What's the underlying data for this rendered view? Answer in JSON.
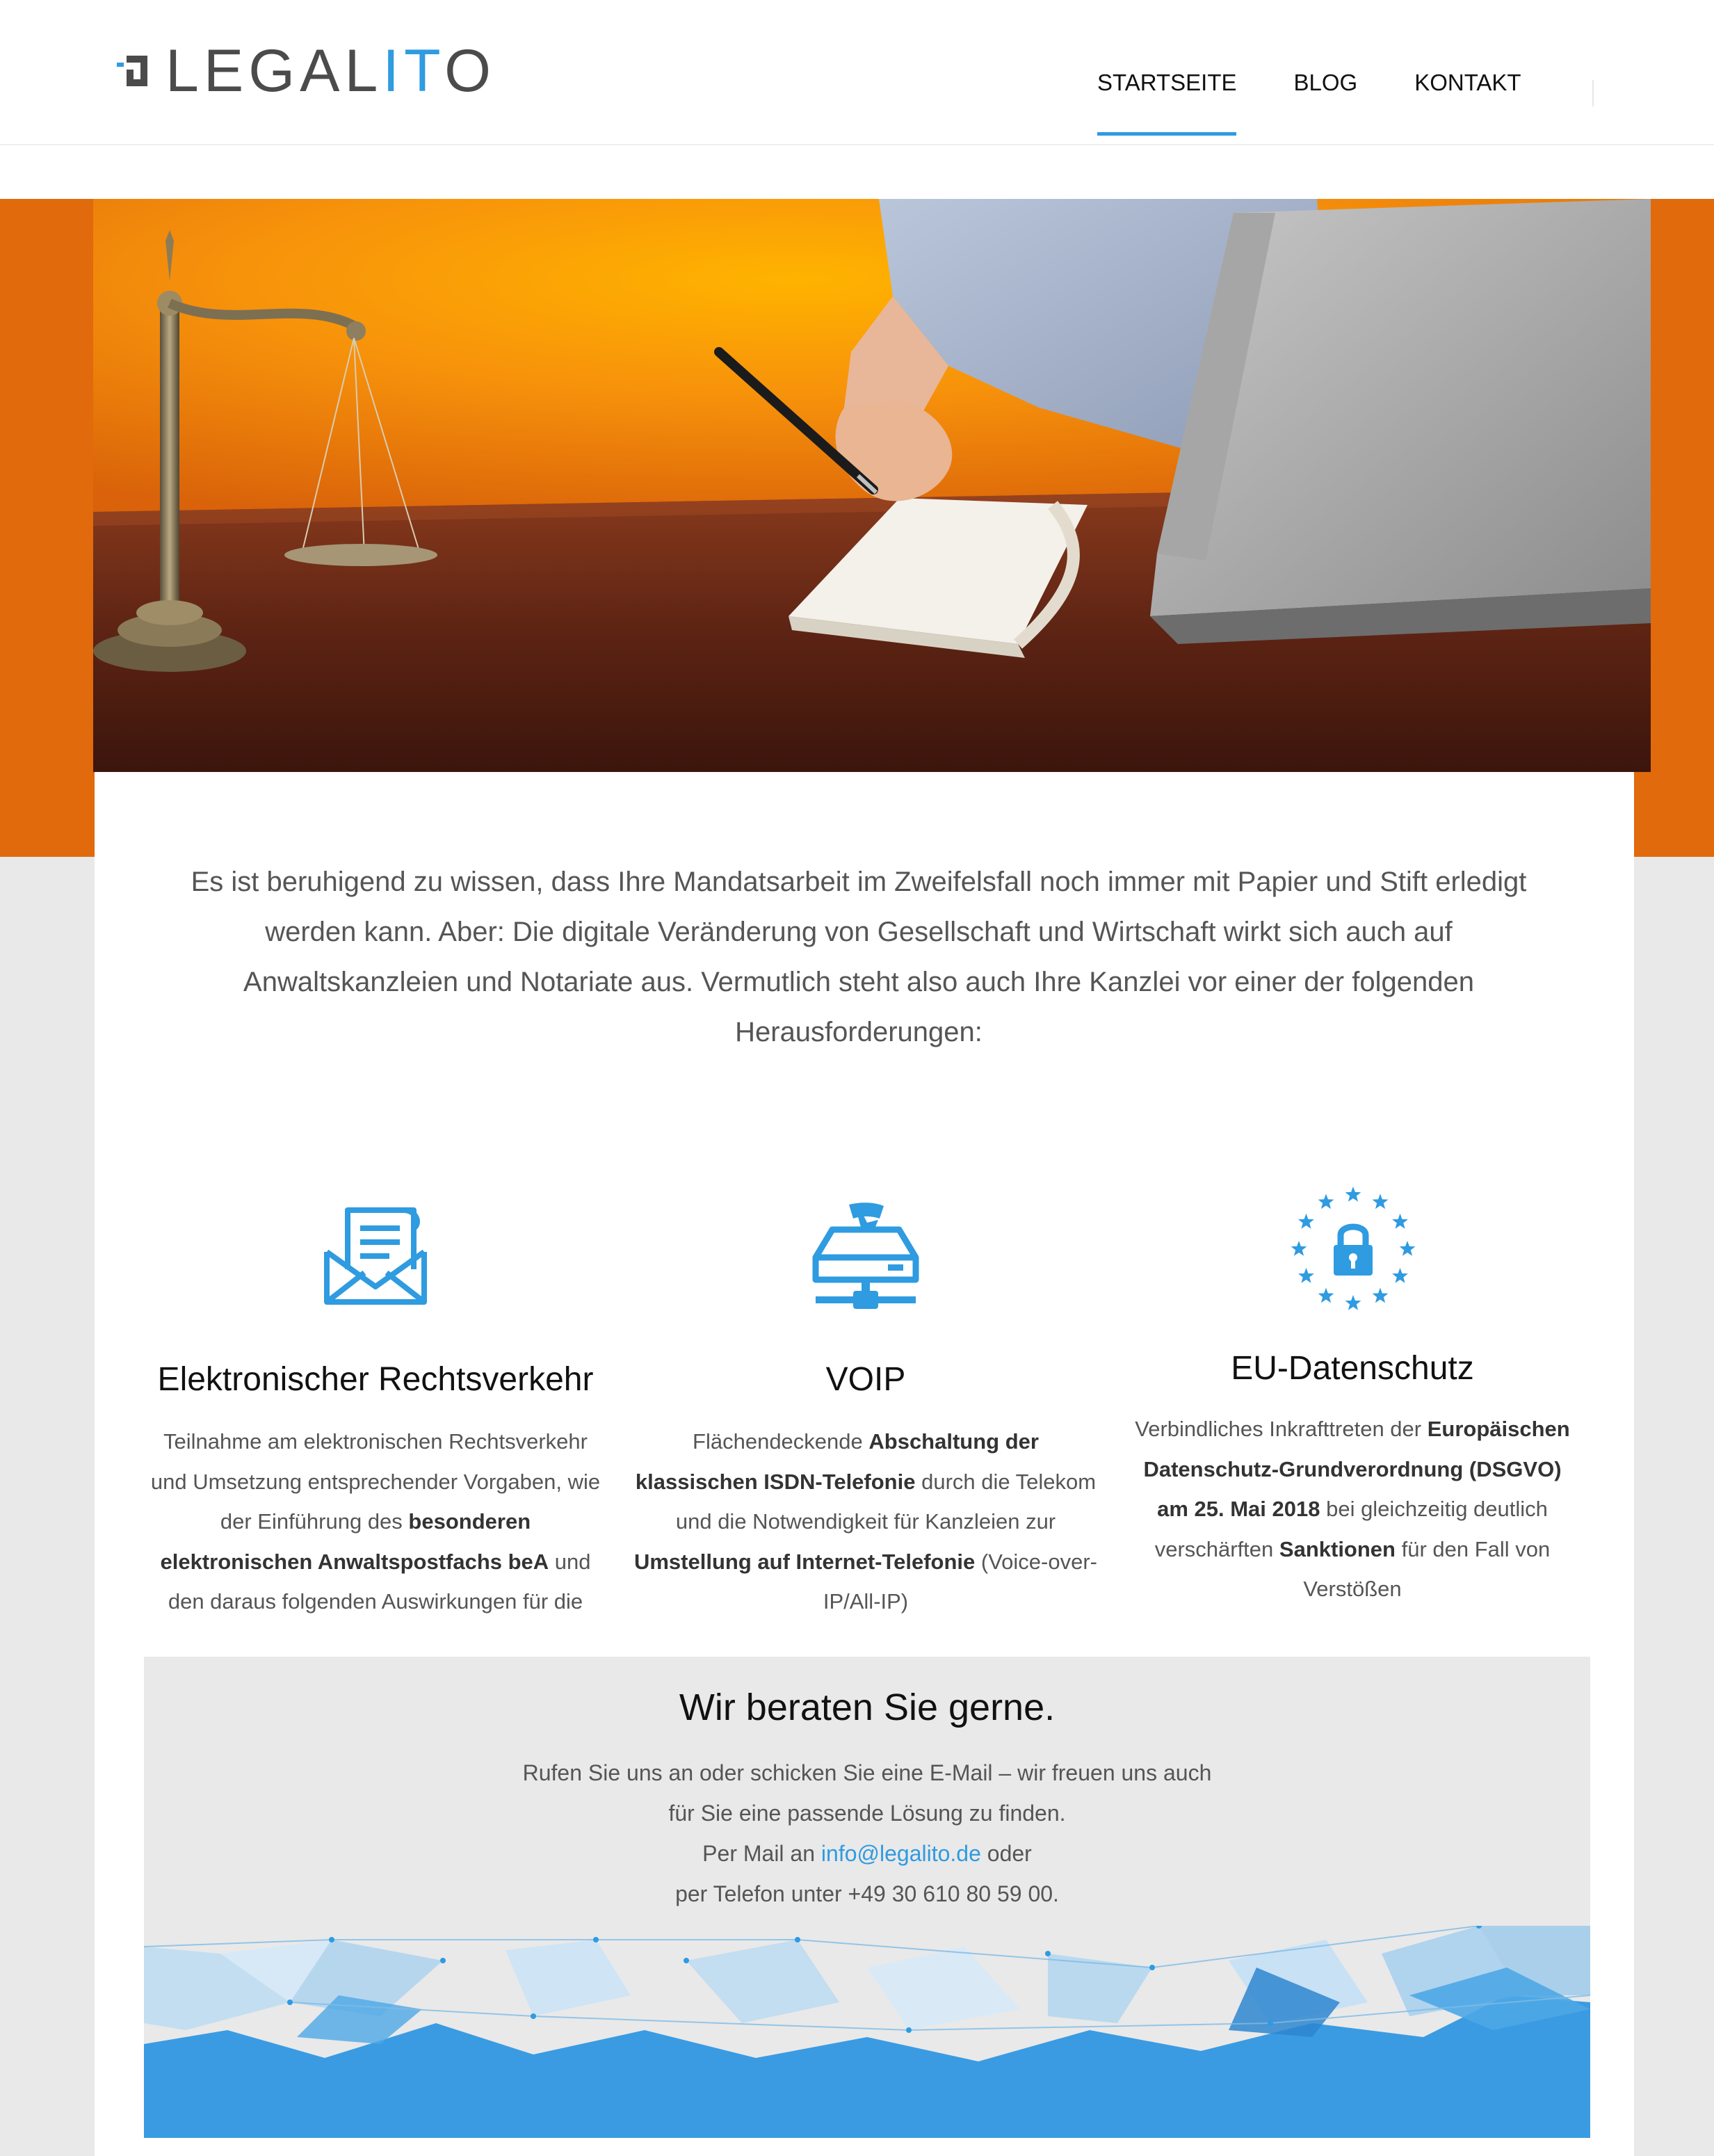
{
  "header": {
    "logo_text": "LEGALITO",
    "nav": [
      {
        "label": "STARTSEITE",
        "active": true
      },
      {
        "label": "BLOG",
        "active": false
      },
      {
        "label": "KONTAKT",
        "active": false
      }
    ]
  },
  "intro": {
    "text": "Es ist beruhigend zu wissen, dass Ihre Mandatsarbeit im Zweifelsfall noch immer mit Papier und Stift erledigt werden kann. Aber: Die digitale Veränderung von Gesellschaft und Wirtschaft wirkt sich auch auf Anwaltskanzleien und Notariate aus. Vermutlich steht also auch Ihre Kanzlei vor einer der folgenden Herausforderungen:"
  },
  "features": [
    {
      "icon": "mail-letter-icon",
      "title": "Elektronischer Rechtsverkehr",
      "p1": "Teilnahme am elektronischen Rechtsverkehr und Umsetzung entsprechender Vorgaben, wie der Einführung des ",
      "b1": "besonderen elektronischen Anwaltspostfachs beA",
      "p2": " und den daraus folgenden Auswirkungen für die",
      "b2": "",
      "p3": "",
      "b3": "",
      "p4": ""
    },
    {
      "icon": "phone-network-icon",
      "title": "VOIP",
      "p1": "Flächendeckende ",
      "b1": "Abschaltung der klassischen ISDN-Telefonie",
      "p2": " durch die Telekom und die Notwendigkeit für Kanzleien zur ",
      "b2": "Umstellung auf Internet-Telefonie",
      "p3": " (Voice-over-IP/All-IP)",
      "b3": "",
      "p4": ""
    },
    {
      "icon": "eu-lock-icon",
      "title": "EU-Datenschutz",
      "p1": "Verbindliches Inkrafttreten der ",
      "b1": "Europäischen Datenschutz-Grundverordnung (DSGVO) am 25. Mai 2018",
      "p2": " bei gleichzeitig deutlich verschärften ",
      "b2": "Sanktionen",
      "p3": " für den Fall von Verstößen",
      "b3": "",
      "p4": ""
    }
  ],
  "contact": {
    "title": "Wir beraten Sie gerne.",
    "line1": "Rufen Sie uns an oder schicken Sie eine E-Mail – wir freuen uns auch",
    "line2": "für Sie eine passende Lösung zu finden.",
    "mail_prefix": "Per Mail an ",
    "email": "info@legalito.de",
    "mail_suffix": " oder",
    "phone_line": "per Telefon unter +49 30 610 80 59 00."
  },
  "colors": {
    "accent": "#2f9be0",
    "hero_orange": "#e16a0c",
    "grey": "#e9e9e9"
  }
}
